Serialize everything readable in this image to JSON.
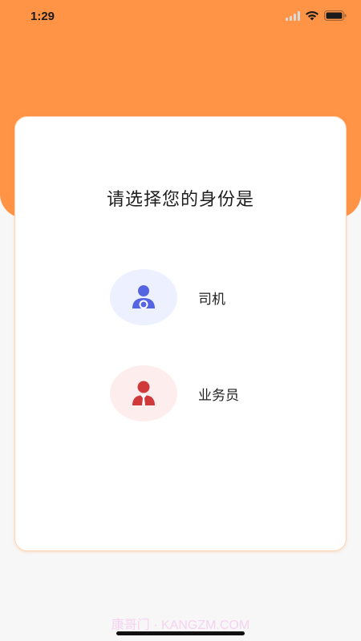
{
  "status_bar": {
    "time": "1:29",
    "icons": [
      "signal-icon",
      "wifi-icon",
      "battery-icon"
    ]
  },
  "colors": {
    "header": "#ff9346",
    "driver_accent": "#5564e0",
    "driver_bg": "#edf0ff",
    "sales_accent": "#d0393c",
    "sales_bg": "#feeded"
  },
  "card": {
    "title": "请选择您的身份是",
    "roles": [
      {
        "id": "driver",
        "label": "司机",
        "icon": "driver-icon"
      },
      {
        "id": "sales",
        "label": "业务员",
        "icon": "salesperson-icon"
      }
    ]
  },
  "watermark": "康哥门 · KANGZM.COM"
}
